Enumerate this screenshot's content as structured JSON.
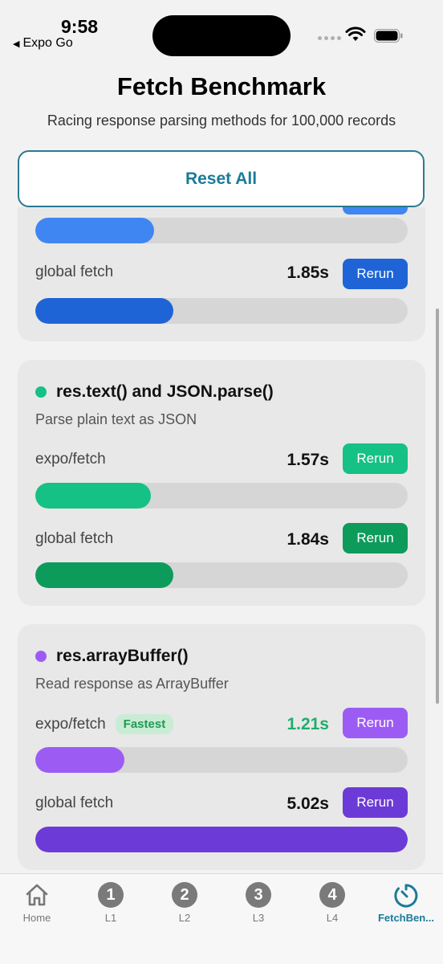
{
  "status_bar": {
    "time": "9:58",
    "back_label": "Expo Go"
  },
  "header": {
    "title": "Fetch Benchmark",
    "subtitle": "Racing response parsing methods for 100,000 records"
  },
  "reset_label": "Reset All",
  "colors": {
    "accent": "#1b7b98",
    "blue": "#3f86f2",
    "blue_dark": "#1e64d6",
    "green": "#15c185",
    "green_dark": "#0d9b5c",
    "purple": "#9c5cf4",
    "purple_dark": "#6c3ad6"
  },
  "cards": [
    {
      "rows": [
        {
          "label": "",
          "time": "",
          "button": "",
          "progress": 0.32,
          "color": "#3f86f2"
        },
        {
          "label": "global fetch",
          "time": "1.85s",
          "button": "Rerun",
          "progress": 0.37,
          "color": "#1e64d6"
        }
      ]
    },
    {
      "title": "res.text() and JSON.parse()",
      "description": "Parse plain text as JSON",
      "dot_color": "#15c185",
      "rows": [
        {
          "label": "expo/fetch",
          "time": "1.57s",
          "button": "Rerun",
          "progress": 0.31,
          "color": "#15c185"
        },
        {
          "label": "global fetch",
          "time": "1.84s",
          "button": "Rerun",
          "progress": 0.37,
          "color": "#0d9b5c"
        }
      ]
    },
    {
      "title": "res.arrayBuffer()",
      "description": "Read response as ArrayBuffer",
      "dot_color": "#9c5cf4",
      "rows": [
        {
          "label": "expo/fetch",
          "badge": "Fastest",
          "time": "1.21s",
          "button": "Rerun",
          "progress": 0.24,
          "color": "#9c5cf4"
        },
        {
          "label": "global fetch",
          "time": "5.02s",
          "button": "Rerun",
          "progress": 1.0,
          "color": "#6c3ad6"
        }
      ]
    }
  ],
  "tabs": [
    {
      "label": "Home",
      "icon": "house-icon"
    },
    {
      "label": "L1",
      "number": "1"
    },
    {
      "label": "L2",
      "number": "2"
    },
    {
      "label": "L3",
      "number": "3"
    },
    {
      "label": "L4",
      "number": "4"
    },
    {
      "label": "FetchBen...",
      "icon": "timer-icon"
    }
  ]
}
